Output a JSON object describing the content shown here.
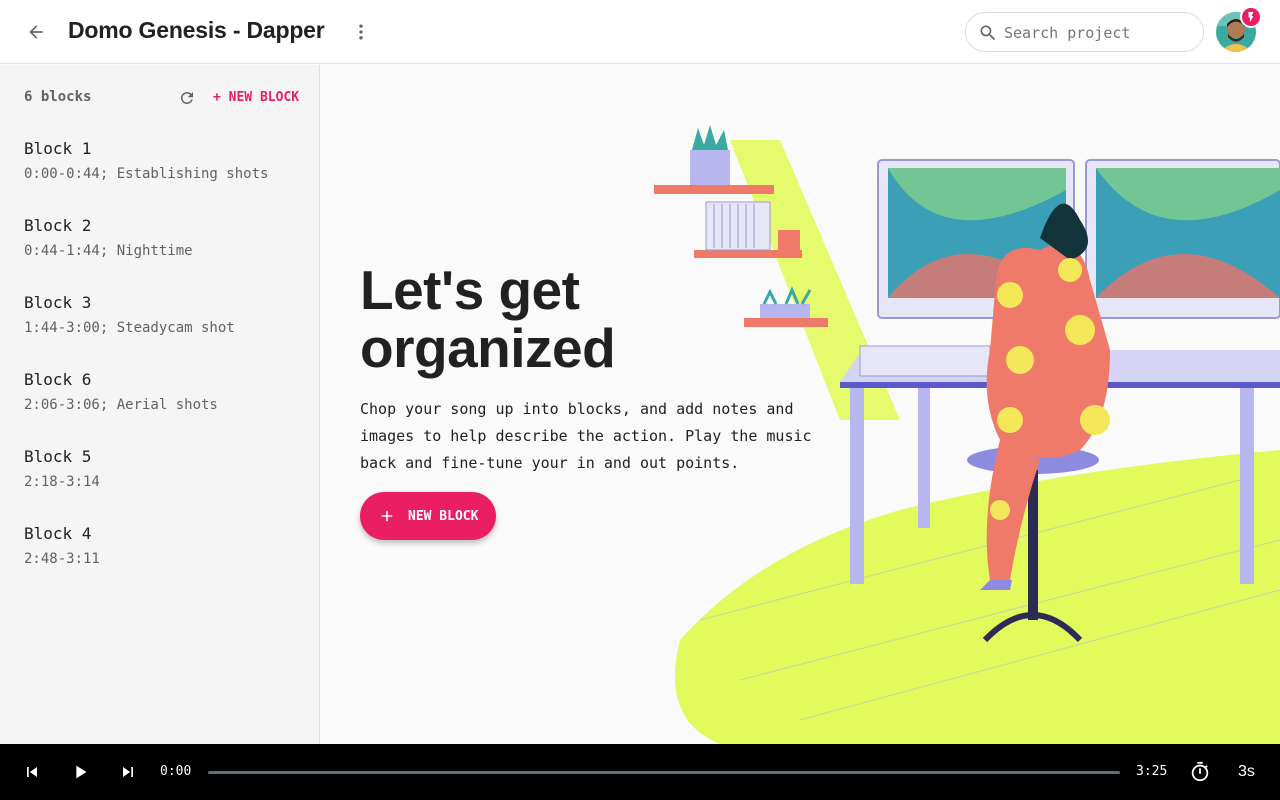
{
  "header": {
    "title": "Domo Genesis - Dapper",
    "search_placeholder": "Search project"
  },
  "sidebar": {
    "count_label": "6 blocks",
    "new_block_label": "+ NEW BLOCK",
    "blocks": [
      {
        "name": "Block 1",
        "desc": "0:00-0:44; Establishing shots"
      },
      {
        "name": "Block 2",
        "desc": "0:44-1:44; Nighttime"
      },
      {
        "name": "Block 3",
        "desc": "1:44-3:00; Steadycam shot"
      },
      {
        "name": "Block 6",
        "desc": "2:06-3:06; Aerial shots"
      },
      {
        "name": "Block 5",
        "desc": "2:18-3:14"
      },
      {
        "name": "Block 4",
        "desc": "2:48-3:11"
      }
    ]
  },
  "main": {
    "headline": "Let's get organized",
    "description": "Chop your song up into blocks, and add notes and images to help describe the action. Play the music back and fine-tune your in and out points.",
    "cta_label": "NEW BLOCK"
  },
  "player": {
    "current_time": "0:00",
    "total_time": "3:25",
    "progress": 0,
    "interval": "3s"
  },
  "colors": {
    "accent": "#e91e63",
    "player_bg": "#000000",
    "sidebar_bg": "#f5f5f5",
    "illustration_green": "#e2fa5c"
  },
  "icons": {
    "back": "arrow-left-icon",
    "more": "more-vert-icon",
    "search": "search-icon",
    "refresh": "refresh-icon",
    "add": "plus-icon",
    "skip_previous": "skip-previous-icon",
    "play": "play-icon",
    "skip_next": "skip-next-icon",
    "timer": "timer-icon"
  }
}
